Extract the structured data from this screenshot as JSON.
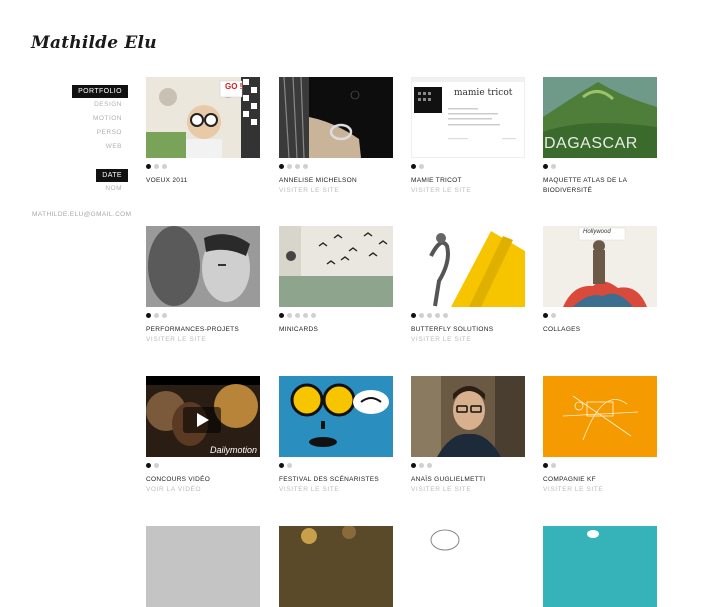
{
  "site": {
    "logo": "Mathilde Elu",
    "email": "MATHILDE.ELU@GMAIL.COM"
  },
  "nav": {
    "sort_active": "PORTFOLIO",
    "categories": [
      "DESIGN",
      "MOTION",
      "PERSO",
      "WEB"
    ],
    "order_active": "DATE",
    "order_other": "NOM"
  },
  "projects": [
    {
      "title": "VOEUX 2011",
      "link": "",
      "dots": 3,
      "active_dot": 0,
      "thumb_text": "GO !"
    },
    {
      "title": "ANNELISE MICHELSON",
      "link": "VISITER LE SITE",
      "dots": 4,
      "active_dot": 0
    },
    {
      "title": "MAMIE TRICOT",
      "link": "VISITER LE SITE",
      "dots": 2,
      "active_dot": 0,
      "thumb_text": "mamie tricot"
    },
    {
      "title": "MAQUETTE ATLAS DE LA BIODIVERSITÉ",
      "link": "",
      "dots": 2,
      "active_dot": 0,
      "thumb_text": "DAGASCAR"
    },
    {
      "title": "PERFORMANCES-PROJETS",
      "link": "VISITER LE SITE",
      "dots": 3,
      "active_dot": 0
    },
    {
      "title": "MINICARDS",
      "link": "",
      "dots": 5,
      "active_dot": 0
    },
    {
      "title": "BUTTERFLY SOLUTIONS",
      "link": "VISITER LE SITE",
      "dots": 5,
      "active_dot": 0
    },
    {
      "title": "COLLAGES",
      "link": "",
      "dots": 2,
      "active_dot": 0,
      "thumb_text": "Hollywood"
    },
    {
      "title": "CONCOURS VIDÉO",
      "link": "VOIR LA VIDÉO",
      "dots": 2,
      "active_dot": 0,
      "thumb_text": "Dailymotion"
    },
    {
      "title": "FESTIVAL DES SCÉNARISTES",
      "link": "VISITER LE SITE",
      "dots": 2,
      "active_dot": 0
    },
    {
      "title": "ANAÏS GUGLIELMETTI",
      "link": "VISITER LE SITE",
      "dots": 3,
      "active_dot": 0
    },
    {
      "title": "COMPAGNIE KF",
      "link": "VISITER LE SITE",
      "dots": 2,
      "active_dot": 0
    },
    {
      "title": "",
      "link": "",
      "dots": 0,
      "active_dot": 0
    },
    {
      "title": "",
      "link": "",
      "dots": 0,
      "active_dot": 0
    },
    {
      "title": "",
      "link": "",
      "dots": 0,
      "active_dot": 0
    },
    {
      "title": "",
      "link": "",
      "dots": 0,
      "active_dot": 0
    }
  ],
  "colors": {
    "accent": "#111111",
    "muted": "#bbbbbb",
    "yellow": "#f6c500",
    "blue": "#2a8fbf",
    "orange": "#f59a00",
    "teal": "#35b3b8"
  }
}
